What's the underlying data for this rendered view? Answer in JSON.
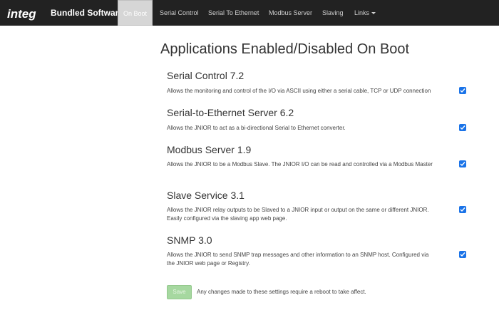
{
  "navbar": {
    "logo_text": "integ",
    "brand": "Bundled Software",
    "items": [
      {
        "label": "On Boot",
        "active": true
      },
      {
        "label": "Serial Control"
      },
      {
        "label": "Serial To Ethernet"
      },
      {
        "label": "Modbus Server"
      },
      {
        "label": "Slaving"
      },
      {
        "label": "Links"
      }
    ]
  },
  "page": {
    "title": "Applications Enabled/Disabled On Boot"
  },
  "apps": [
    {
      "name": "Serial Control 7.2",
      "desc": "Allows the monitoring and control of the I/O via ASCII using either a serial cable, TCP or UDP connection",
      "checked": true
    },
    {
      "name": "Serial-to-Ethernet Server 6.2",
      "desc": "Allows the JNIOR to act as a bi-directional Serial to Ethernet converter.",
      "checked": true
    },
    {
      "name": "Modbus Server 1.9",
      "desc": "Allows the JNIOR to be a Modbus Slave. The JNIOR I/O can be read and controlled via a Modbus Master",
      "checked": true
    },
    {
      "name": "Slave Service 3.1",
      "desc": "Allows the JNIOR relay outputs to be Slaved to a JNIOR input or output on the same or different JNIOR. Easily configured via the slaving app web page.",
      "checked": true
    },
    {
      "name": "SNMP 3.0",
      "desc": "Allows the JNIOR to send SNMP trap messages and other information to an SNMP host. Configured via the JNIOR web page or Registry.",
      "checked": true
    }
  ],
  "footer": {
    "save_label": "Save",
    "note": "Any changes made to these settings require a reboot to take affect."
  },
  "colors": {
    "navbar_bg": "#222222",
    "check_blue": "#1a73e8",
    "save_green": "#a6d8a0"
  }
}
